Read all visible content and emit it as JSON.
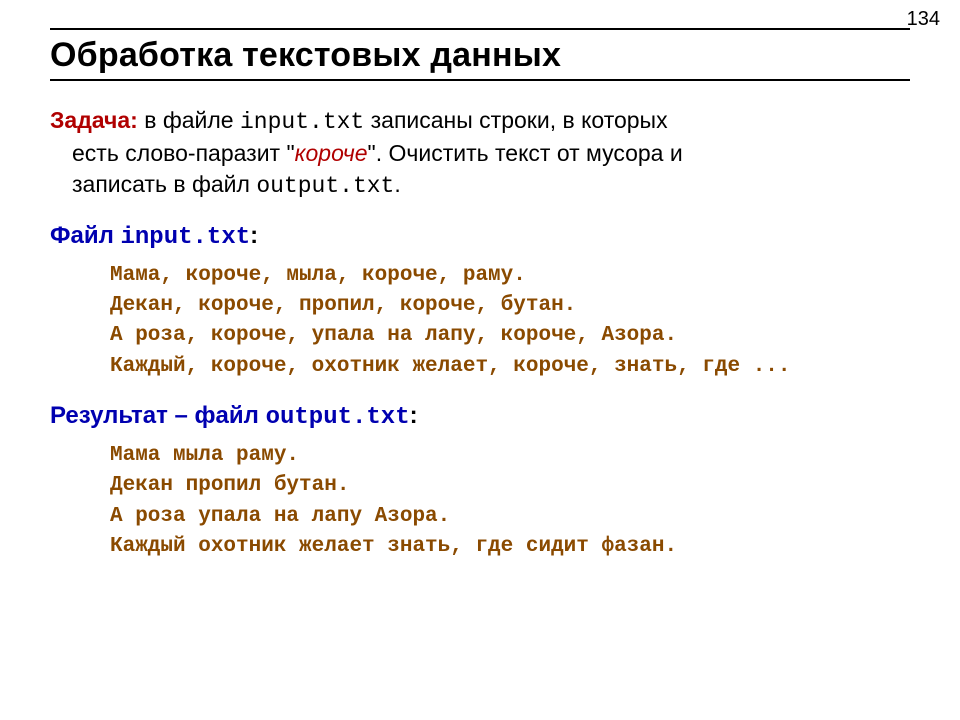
{
  "page_number": "134",
  "title": "Обработка текстовых данных",
  "task": {
    "label": "Задача:",
    "t1": " в файле ",
    "f_in": "input.txt",
    "t2": " записаны строки, в которых",
    "t3": "есть слово-паразит \"",
    "parasite": "короче",
    "t4": "\". Очистить текст от мусора и",
    "t5": "записать в файл ",
    "f_out": "output.txt",
    "t6": "."
  },
  "input_heading": {
    "prefix": "Файл ",
    "file": "input.txt",
    "suffix": ":"
  },
  "input_lines": "Мама, короче, мыла, короче, раму.\nДекан, короче, пропил, короче, бутан.\nА роза, короче, упала на лапу, короче, Азора.\nКаждый, короче, охотник желает, короче, знать, где ...",
  "output_heading": {
    "prefix": "Результат – файл ",
    "file": "output.txt",
    "suffix": ":"
  },
  "output_lines": "Мама мыла раму.\nДекан пропил бутан.\nА роза упала на лапу Азора.\nКаждый охотник желает знать, где сидит фазан."
}
